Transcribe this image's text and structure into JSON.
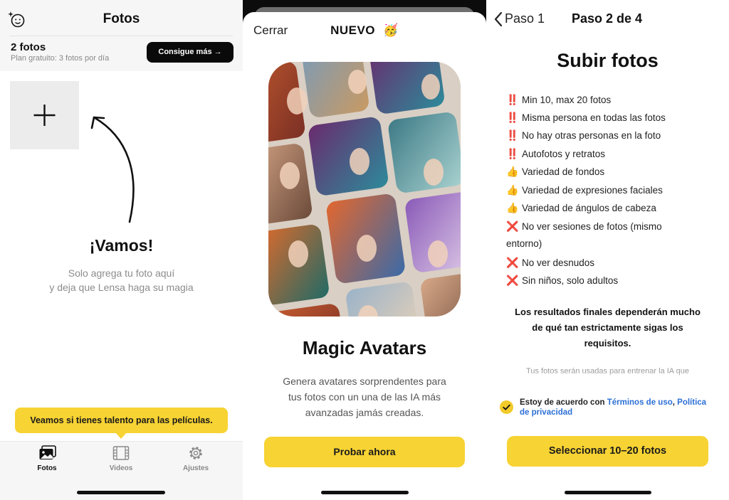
{
  "panel1": {
    "title": "Fotos",
    "photo_count": "2 fotos",
    "plan_text": "Plan gratuito: 3 fotos por día",
    "get_more_button": "Consigue más →",
    "headline": "¡Vamos!",
    "subtitle_line1": "Solo agrega tu foto aquí",
    "subtitle_line2": "y deja que Lensa haga su magia",
    "tooltip": "Veamos si tienes talento para las películas.",
    "tabs": [
      {
        "label": "Fotos",
        "icon": "photos-icon",
        "active": true
      },
      {
        "label": "Videos",
        "icon": "film-icon",
        "active": false
      },
      {
        "label": "Ajustes",
        "icon": "gear-icon",
        "active": false
      }
    ]
  },
  "panel2": {
    "close_label": "Cerrar",
    "header_title": "NUEVO",
    "header_emoji": "🥳",
    "title": "Magic Avatars",
    "description_line1": "Genera avatares sorprendentes para",
    "description_line2": "tus fotos con un una de las IA más",
    "description_line3": "avanzadas jamás creadas.",
    "cta_button": "Probar ahora"
  },
  "panel3": {
    "back_label": "Paso 1",
    "step_title": "Paso 2 de 4",
    "title": "Subir fotos",
    "requirements": [
      {
        "icon": "‼️",
        "text": "Min 10, max 20 fotos"
      },
      {
        "icon": "‼️",
        "text": "Misma persona en todas las fotos"
      },
      {
        "icon": "‼️",
        "text": "No hay otras personas en la foto"
      },
      {
        "icon": "‼️",
        "text": "Autofotos y retratos"
      },
      {
        "icon": "👍",
        "text": "Variedad de fondos"
      },
      {
        "icon": "👍",
        "text": "Variedad de expresiones faciales"
      },
      {
        "icon": "👍",
        "text": "Variedad de ángulos de cabeza"
      },
      {
        "icon": "❌",
        "text": "No ver sesiones de fotos (mismo"
      },
      {
        "icon": "",
        "text": "entorno)"
      },
      {
        "icon": "❌",
        "text": "No ver desnudos"
      },
      {
        "icon": "❌",
        "text": "Sin niños, solo adultos"
      }
    ],
    "final_line1": "Los resultados finales dependerán mucho",
    "final_line2": "de qué tan estrictamente sigas los",
    "final_line3": "requisitos.",
    "training_note": "Tus fotos serán usadas para entrenar la IA que",
    "agree_prefix": "Estoy de acuerdo con",
    "terms_link": "Términos de uso",
    "comma": ",",
    "privacy_part1": "Política",
    "privacy_part2": "de privacidad",
    "select_button": "Seleccionar 10–20 fotos"
  },
  "colors": {
    "accent_yellow": "#f7d333",
    "link_blue": "#2c6fd6",
    "dark_button": "#0a0a0a"
  }
}
